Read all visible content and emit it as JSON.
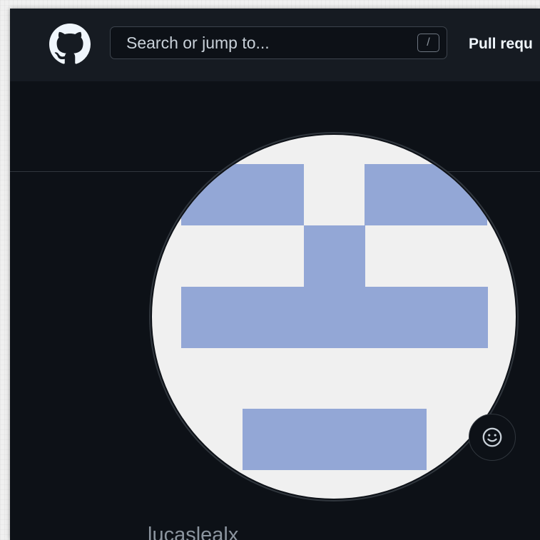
{
  "header": {
    "search_placeholder": "Search or jump to...",
    "search_shortcut": "/",
    "nav_pull_requests": "Pull requ"
  },
  "profile": {
    "username": "lucaslealx"
  },
  "icons": {
    "logo": "github-octocat-icon",
    "status": "smiley-icon"
  },
  "colors": {
    "page_bg": "#0d1117",
    "header_bg": "#161b22",
    "identicon_fg": "#93a7d6",
    "identicon_bg": "#f0f0f0"
  }
}
